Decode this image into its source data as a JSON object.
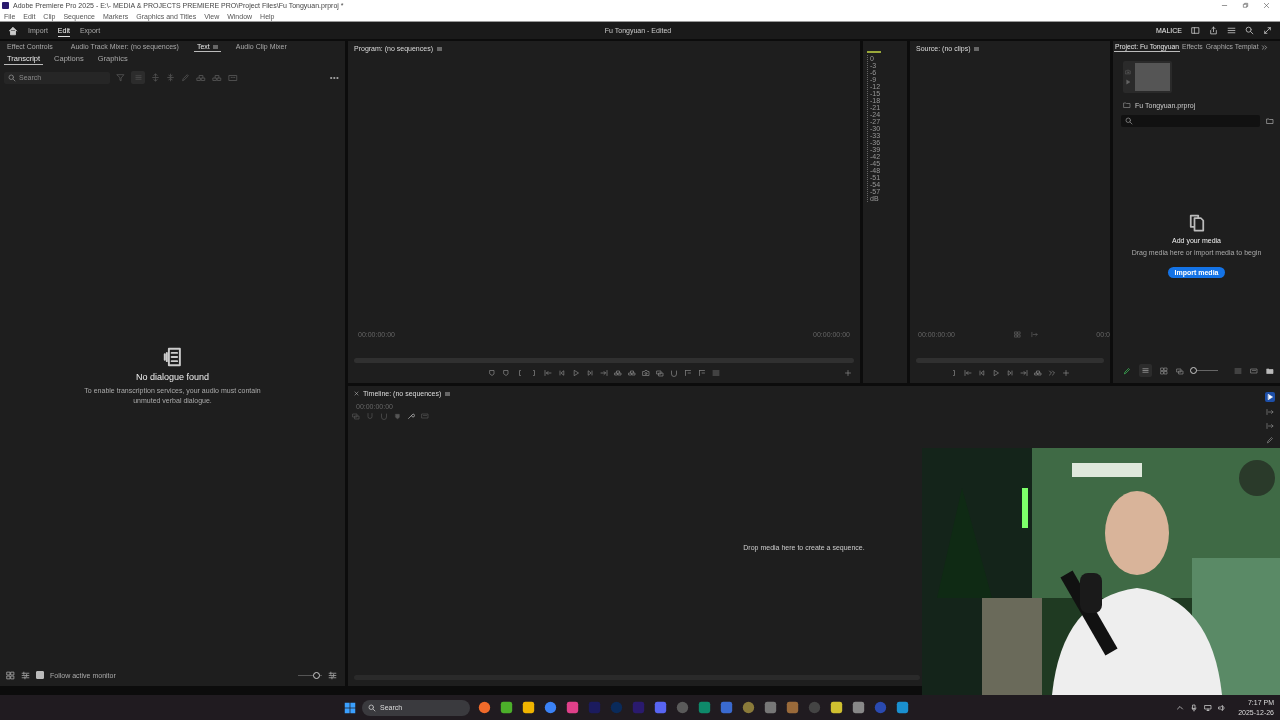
{
  "window": {
    "title": "Adobe Premiere Pro 2025 - E:\\- MEDIA & PROJECTS PREMIERE PRO\\Project Files\\Fu Tongyuan.prproj *"
  },
  "menu": [
    "File",
    "Edit",
    "Clip",
    "Sequence",
    "Markers",
    "Graphics and Titles",
    "View",
    "Window",
    "Help"
  ],
  "workspaces": [
    {
      "label": "Import",
      "selected": false
    },
    {
      "label": "Edit",
      "selected": true
    },
    {
      "label": "Export",
      "selected": false
    }
  ],
  "header_title": "Fu Tongyuan - Edited",
  "user": "MALICE",
  "left_panel": {
    "tabs": [
      {
        "label": "Effect Controls",
        "selected": false
      },
      {
        "label": "Audio Track Mixer: (no sequences)",
        "selected": false
      },
      {
        "label": "Text",
        "selected": true
      },
      {
        "label": "Audio Clip Mixer",
        "selected": false
      }
    ],
    "subtabs": [
      {
        "label": "Transcript",
        "selected": true
      },
      {
        "label": "Captions",
        "selected": false
      },
      {
        "label": "Graphics",
        "selected": false
      }
    ],
    "search": {
      "placeholder": "Search"
    },
    "empty_title": "No dialogue found",
    "empty_text": "To enable transcription services, your audio must contain unmuted verbal dialogue.",
    "follow": {
      "label": "Follow active monitor",
      "checked": true
    },
    "zoom": {
      "level": 0.75
    }
  },
  "program": {
    "title": "Program: (no sequences)",
    "timecode_in": "00:00:00:00",
    "timecode_out": "00:00:00:00"
  },
  "meter": {
    "ticks": [
      "0",
      "-3",
      "-6",
      "-9",
      "-12",
      "-15",
      "-18",
      "-21",
      "-24",
      "-27",
      "-30",
      "-33",
      "-36",
      "-39",
      "-42",
      "-45",
      "-48",
      "-51",
      "-54",
      "-57",
      "dB"
    ]
  },
  "source": {
    "title": "Source: (no clips)",
    "timecode_in": "00:00:00:00",
    "timecode_out": "00:0"
  },
  "project": {
    "tabs": [
      {
        "label": "Project: Fu Tongyuan",
        "selected": true
      },
      {
        "label": "Effects",
        "selected": false
      },
      {
        "label": "Graphics Templat",
        "selected": false
      }
    ],
    "file": "Fu Tongyuan.prproj",
    "empty_title": "Add your media",
    "empty_text": "Drag media here or import media to begin",
    "button": "Import media",
    "zoom": {
      "level": 0.05
    }
  },
  "timeline": {
    "title": "Timeline: (no sequences)",
    "timecode": "00:00:00:00",
    "drop_text": "Drop media here to create a sequence."
  },
  "taskbar": {
    "search": {
      "placeholder": "Search"
    },
    "time": "7:17 PM",
    "date": "2025-12-26"
  }
}
